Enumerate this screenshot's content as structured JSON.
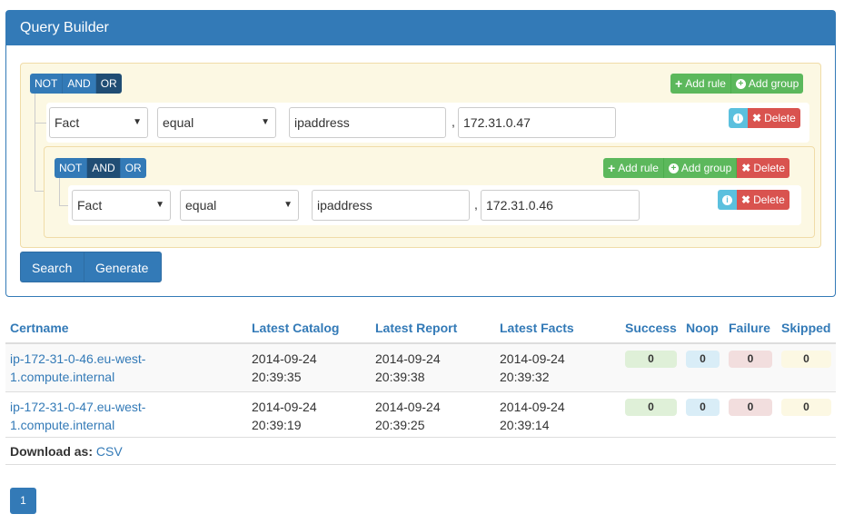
{
  "panel": {
    "title": "Query Builder"
  },
  "conditions": {
    "not": "NOT",
    "and": "AND",
    "or": "OR"
  },
  "group_buttons": {
    "add_rule": "Add rule",
    "add_group": "Add group",
    "delete": "Delete"
  },
  "rule1": {
    "field": "Fact",
    "operator": "equal",
    "name": "ipaddress",
    "separator": ",",
    "value": "172.31.0.47"
  },
  "rule2": {
    "field": "Fact",
    "operator": "equal",
    "name": "ipaddress",
    "separator": ",",
    "value": "172.31.0.46"
  },
  "actions": {
    "search": "Search",
    "generate": "Generate"
  },
  "table": {
    "headers": [
      "Certname",
      "Latest Catalog",
      "Latest Report",
      "Latest Facts",
      "Success",
      "Noop",
      "Failure",
      "Skipped"
    ],
    "rows": [
      {
        "certname_1": "ip-172-31-0-46.eu-west-",
        "certname_2": "1.compute.internal",
        "catalog_date": "2014-09-24",
        "catalog_time": "20:39:35",
        "report_date": "2014-09-24",
        "report_time": "20:39:38",
        "facts_date": "2014-09-24",
        "facts_time": "20:39:32",
        "success": "0",
        "noop": "0",
        "failure": "0",
        "skipped": "0"
      },
      {
        "certname_1": "ip-172-31-0-47.eu-west-",
        "certname_2": "1.compute.internal",
        "catalog_date": "2014-09-24",
        "catalog_time": "20:39:19",
        "report_date": "2014-09-24",
        "report_time": "20:39:25",
        "facts_date": "2014-09-24",
        "facts_time": "20:39:14",
        "success": "0",
        "noop": "0",
        "failure": "0",
        "skipped": "0"
      }
    ]
  },
  "download": {
    "label": "Download as:",
    "csv": "CSV"
  },
  "pagination": {
    "page": "1"
  },
  "colors": {
    "primary": "#337ab7",
    "success": "#5cb85c",
    "danger": "#d9534f",
    "info": "#5bc0de",
    "group_bg": "#fcf8e3"
  }
}
